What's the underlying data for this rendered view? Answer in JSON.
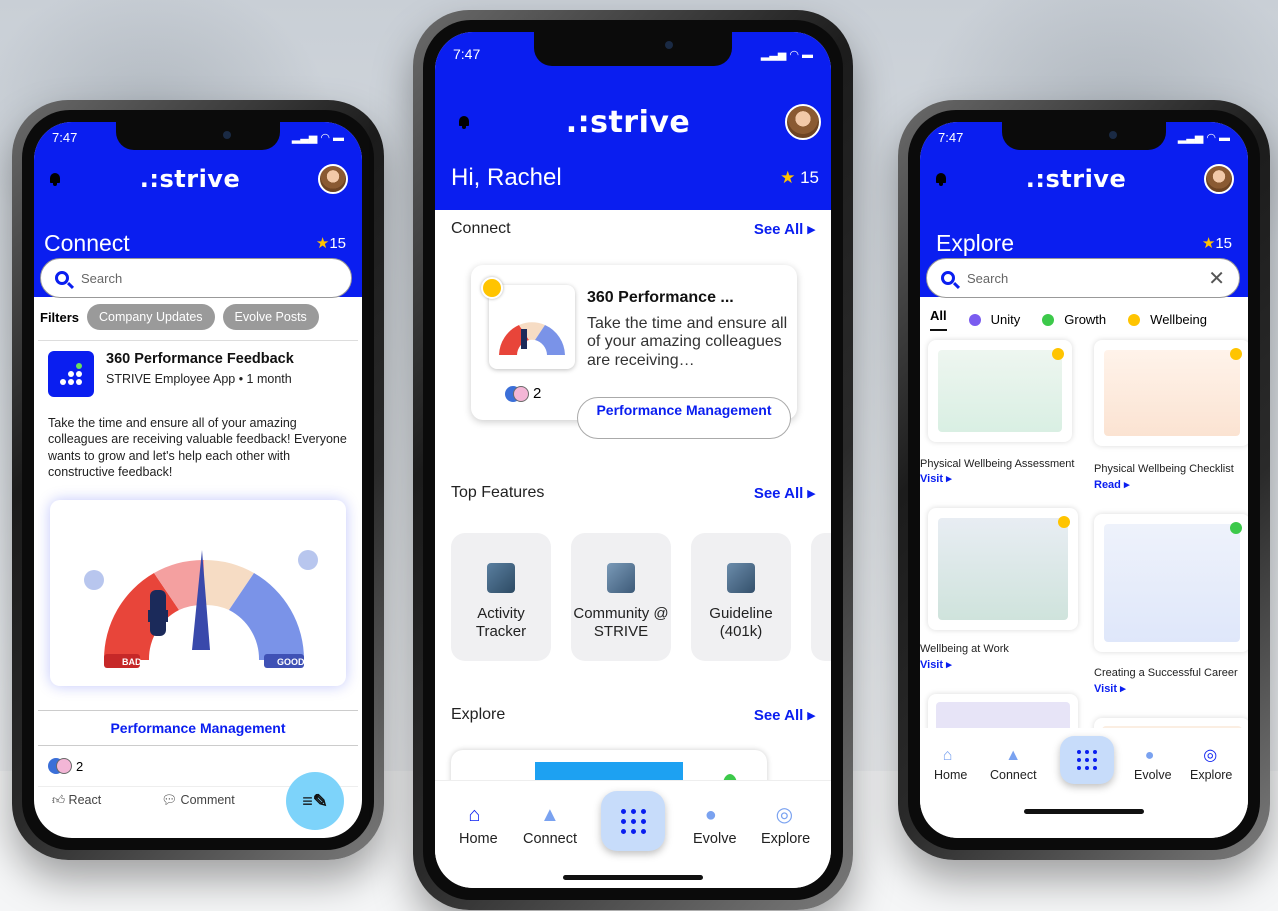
{
  "left": {
    "time": "7:47",
    "logo": ".:strive",
    "title": "Connect",
    "points": "15",
    "search_placeholder": "Search",
    "filters_label": "Filters",
    "filters": [
      "Company Updates",
      "Evolve Posts"
    ],
    "post": {
      "title": "360 Performance Feedback",
      "subtitle": "STRIVE Employee App • 1 month",
      "body": "Take the time and ensure all of your amazing colleagues are receiving valuable feedback! Everyone wants to grow and let's help each other with constructive feedback!",
      "gauge_bad": "BAD",
      "gauge_good": "GOOD",
      "button": "Performance Management",
      "reaction_count": "2",
      "react": "React",
      "comment": "Comment"
    }
  },
  "center": {
    "time": "7:47",
    "logo": ".:strive",
    "greeting": "Hi, Rachel",
    "points": "15",
    "connect": {
      "title": "Connect",
      "see_all": "See All",
      "card_title": "360 Performance ...",
      "card_desc": "Take the time and ensure all of your amazing colleagues are receiving…",
      "reaction_count": "2",
      "button": "Performance Management"
    },
    "features": {
      "title": "Top Features",
      "see_all": "See All",
      "items": [
        "Activity Tracker",
        "Community @ STRIVE",
        "Guideline (401k)"
      ]
    },
    "explore": {
      "title": "Explore",
      "see_all": "See All"
    },
    "tabs": {
      "home": "Home",
      "connect": "Connect",
      "evolve": "Evolve",
      "explore": "Explore"
    }
  },
  "right": {
    "time": "7:47",
    "logo": ".:strive",
    "title": "Explore",
    "points": "15",
    "search_placeholder": "Search",
    "categories": [
      "All",
      "Unity",
      "Growth",
      "Wellbeing"
    ],
    "tiles": [
      {
        "label": "Physical Wellbeing Assessment",
        "link": "Visit"
      },
      {
        "label": "Physical Wellbeing Checklist",
        "link": "Read"
      },
      {
        "label": "Wellbeing at Work",
        "link": "Visit"
      },
      {
        "label": "Creating a Successful Career",
        "link": "Visit"
      }
    ],
    "tabs": {
      "home": "Home",
      "connect": "Connect",
      "evolve": "Evolve",
      "explore": "Explore"
    }
  },
  "colors": {
    "brand_blue": "#0a1ef0",
    "star": "#ffc400",
    "fab": "#7dd3fa"
  }
}
